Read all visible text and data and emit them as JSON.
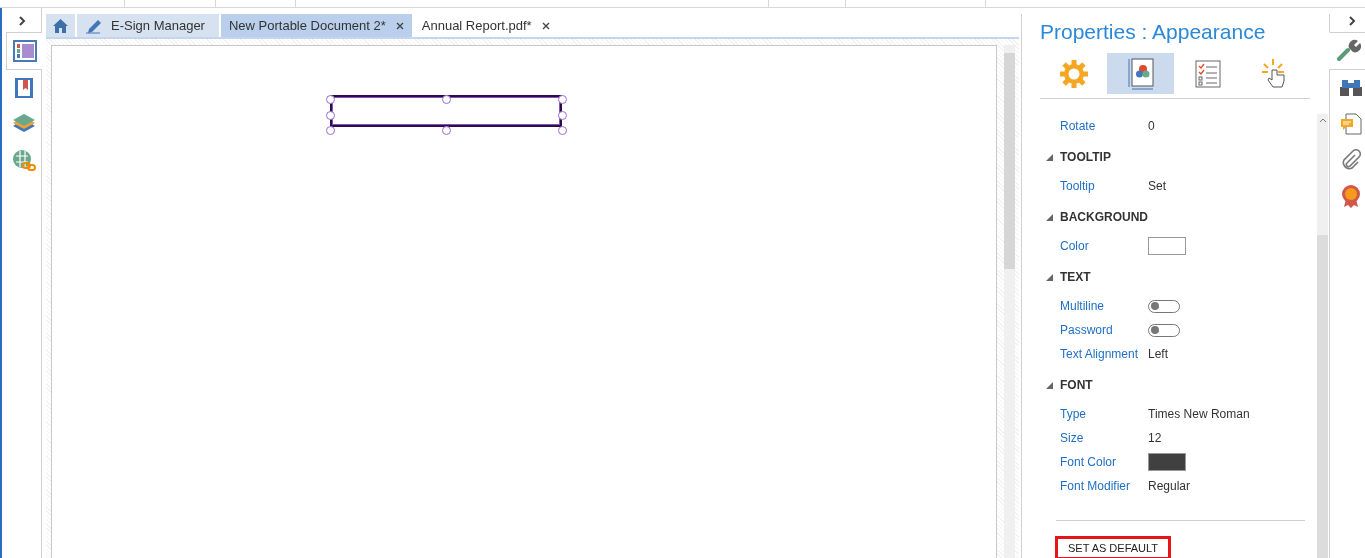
{
  "document_tabs": [
    {
      "kind": "home",
      "selected": false
    },
    {
      "kind": "signer",
      "label": "E-Sign Manager",
      "selected": false
    },
    {
      "kind": "document",
      "label": "New Portable Document 2*",
      "selected": true
    },
    {
      "kind": "document",
      "label": "Annual Report.pdf*",
      "selected": false
    }
  ],
  "left_sidebar": {
    "items": [
      {
        "kind": "pages",
        "selected": true
      },
      {
        "kind": "bookmarks",
        "selected": false
      },
      {
        "kind": "layers",
        "selected": false
      },
      {
        "kind": "links",
        "selected": false
      }
    ]
  },
  "canvas": {
    "fields": [
      {
        "kind": "text_field",
        "selected": true
      }
    ]
  },
  "properties": {
    "title": "Properties : Appearance",
    "tabs": [
      {
        "kind": "general",
        "selected": false
      },
      {
        "kind": "appearance",
        "selected": true
      },
      {
        "kind": "options",
        "selected": false
      },
      {
        "kind": "actions",
        "selected": false
      }
    ],
    "rows": [
      {
        "kind": "text",
        "label": "Rotate",
        "value": "0"
      }
    ],
    "sections": [
      {
        "title": "TOOLTIP",
        "expanded": true,
        "rows": [
          {
            "kind": "text",
            "label": "Tooltip",
            "value": "Set"
          }
        ]
      },
      {
        "title": "BACKGROUND",
        "expanded": true,
        "rows": [
          {
            "kind": "swatch",
            "label": "Color",
            "color": "#ffffff"
          }
        ]
      },
      {
        "title": "TEXT",
        "expanded": true,
        "rows": [
          {
            "kind": "toggle",
            "label": "Multiline",
            "on": false
          },
          {
            "kind": "toggle",
            "label": "Password",
            "on": false
          },
          {
            "kind": "text",
            "label": "Text Alignment",
            "value": "Left"
          }
        ]
      },
      {
        "title": "FONT",
        "expanded": true,
        "rows": [
          {
            "kind": "text",
            "label": "Type",
            "value": "Times New Roman"
          },
          {
            "kind": "text",
            "label": "Size",
            "value": "12"
          },
          {
            "kind": "swatch",
            "label": "Font Color",
            "color": "#404040"
          },
          {
            "kind": "text",
            "label": "Font Modifier",
            "value": "Regular"
          }
        ]
      }
    ],
    "button": "SET AS DEFAULT"
  },
  "right_sidebar": {
    "items": [
      {
        "kind": "wrench",
        "selected": true
      },
      {
        "kind": "binoculars",
        "selected": false
      },
      {
        "kind": "comment",
        "selected": false
      },
      {
        "kind": "attachment",
        "selected": false
      },
      {
        "kind": "badge",
        "selected": false
      }
    ]
  }
}
